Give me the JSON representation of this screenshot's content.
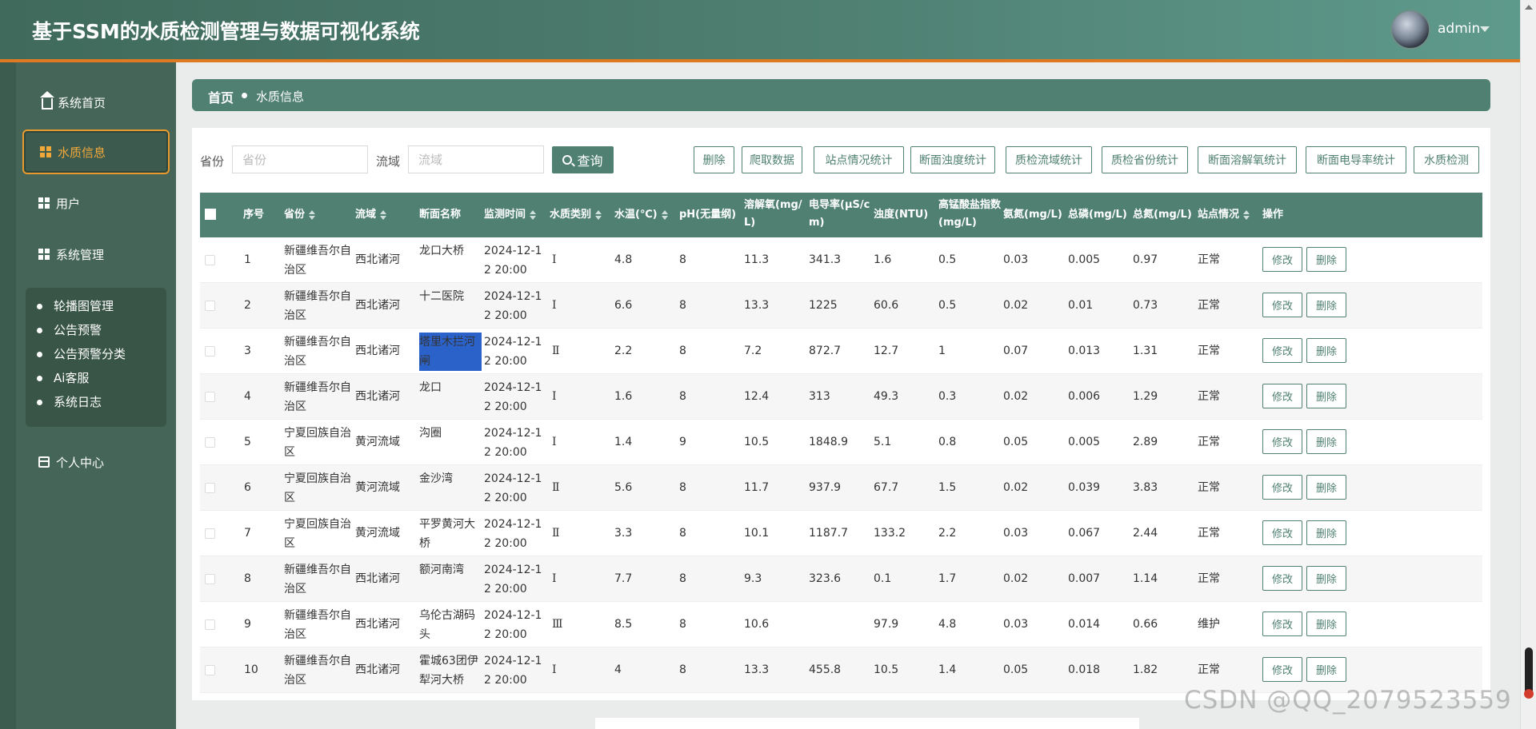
{
  "app": {
    "title": "基于SSM的水质检测管理与数据可视化系统",
    "user": "admin"
  },
  "sidebar": {
    "items": [
      {
        "label": "系统首页",
        "icon": "home-icon"
      },
      {
        "label": "水质信息",
        "icon": "grid-icon"
      },
      {
        "label": "用户",
        "icon": "grid-icon"
      },
      {
        "label": "系统管理",
        "icon": "grid-icon"
      }
    ],
    "submenu": [
      "轮播图管理",
      "公告预警",
      "公告预警分类",
      "Ai客服",
      "系统日志"
    ],
    "personal": "个人中心"
  },
  "breadcrumb": {
    "home": "首页",
    "current": "水质信息"
  },
  "search": {
    "province_label": "省份",
    "province_placeholder": "省份",
    "basin_label": "流域",
    "basin_placeholder": "流域",
    "query_label": "查询"
  },
  "toolbar": [
    "删除",
    "爬取数据",
    "站点情况统计",
    "断面浊度统计",
    "质检流域统计",
    "质检省份统计",
    "断面溶解氧统计",
    "断面电导率统计",
    "水质检测"
  ],
  "table": {
    "headers": [
      "序号",
      "省份",
      "流域",
      "断面名称",
      "监测时间",
      "水质类别",
      "水温(℃)",
      "pH(无量纲)",
      "溶解氧(mg/L)",
      "电导率(μS/cm)",
      "浊度(NTU)",
      "高锰酸盐指数(mg/L)",
      "氨氮(mg/L)",
      "总磷(mg/L)",
      "总氮(mg/L)",
      "站点情况",
      "操作"
    ],
    "edit_label": "修改",
    "delete_label": "删除",
    "rows": [
      {
        "no": "1",
        "province": "新疆维吾尔自治区",
        "basin": "西北诸河",
        "section": "龙口大桥",
        "time": "2024-12-12 20:00",
        "cls": "Ⅰ",
        "temp": "4.8",
        "ph": "8",
        "do": "11.3",
        "cond": "341.3",
        "turb": "1.6",
        "kmn": "0.5",
        "nh": "0.03",
        "tp": "0.005",
        "tn": "0.97",
        "status": "正常"
      },
      {
        "no": "2",
        "province": "新疆维吾尔自治区",
        "basin": "西北诸河",
        "section": "十二医院",
        "time": "2024-12-12 20:00",
        "cls": "Ⅰ",
        "temp": "6.6",
        "ph": "8",
        "do": "13.3",
        "cond": "1225",
        "turb": "60.6",
        "kmn": "0.5",
        "nh": "0.02",
        "tp": "0.01",
        "tn": "0.73",
        "status": "正常"
      },
      {
        "no": "3",
        "province": "新疆维吾尔自治区",
        "basin": "西北诸河",
        "section": "塔里木拦河闸",
        "time": "2024-12-12 20:00",
        "cls": "Ⅱ",
        "temp": "2.2",
        "ph": "8",
        "do": "7.2",
        "cond": "872.7",
        "turb": "12.7",
        "kmn": "1",
        "nh": "0.07",
        "tp": "0.013",
        "tn": "1.31",
        "status": "正常"
      },
      {
        "no": "4",
        "province": "新疆维吾尔自治区",
        "basin": "西北诸河",
        "section": "龙口",
        "time": "2024-12-12 20:00",
        "cls": "Ⅰ",
        "temp": "1.6",
        "ph": "8",
        "do": "12.4",
        "cond": "313",
        "turb": "49.3",
        "kmn": "0.3",
        "nh": "0.02",
        "tp": "0.006",
        "tn": "1.29",
        "status": "正常"
      },
      {
        "no": "5",
        "province": "宁夏回族自治区",
        "basin": "黄河流域",
        "section": "沟圈",
        "time": "2024-12-12 20:00",
        "cls": "Ⅰ",
        "temp": "1.4",
        "ph": "9",
        "do": "10.5",
        "cond": "1848.9",
        "turb": "5.1",
        "kmn": "0.8",
        "nh": "0.05",
        "tp": "0.005",
        "tn": "2.89",
        "status": "正常"
      },
      {
        "no": "6",
        "province": "宁夏回族自治区",
        "basin": "黄河流域",
        "section": "金沙湾",
        "time": "2024-12-12 20:00",
        "cls": "Ⅱ",
        "temp": "5.6",
        "ph": "8",
        "do": "11.7",
        "cond": "937.9",
        "turb": "67.7",
        "kmn": "1.5",
        "nh": "0.02",
        "tp": "0.039",
        "tn": "3.83",
        "status": "正常"
      },
      {
        "no": "7",
        "province": "宁夏回族自治区",
        "basin": "黄河流域",
        "section": "平罗黄河大桥",
        "time": "2024-12-12 20:00",
        "cls": "Ⅱ",
        "temp": "3.3",
        "ph": "8",
        "do": "10.1",
        "cond": "1187.7",
        "turb": "133.2",
        "kmn": "2.2",
        "nh": "0.03",
        "tp": "0.067",
        "tn": "2.44",
        "status": "正常"
      },
      {
        "no": "8",
        "province": "新疆维吾尔自治区",
        "basin": "西北诸河",
        "section": "额河南湾",
        "time": "2024-12-12 20:00",
        "cls": "Ⅰ",
        "temp": "7.7",
        "ph": "8",
        "do": "9.3",
        "cond": "323.6",
        "turb": "0.1",
        "kmn": "1.7",
        "nh": "0.02",
        "tp": "0.007",
        "tn": "1.14",
        "status": "正常"
      },
      {
        "no": "9",
        "province": "新疆维吾尔自治区",
        "basin": "西北诸河",
        "section": "乌伦古湖码头",
        "time": "2024-12-12 20:00",
        "cls": "Ⅲ",
        "temp": "8.5",
        "ph": "8",
        "do": "10.6",
        "cond": "",
        "turb": "97.9",
        "kmn": "4.8",
        "nh": "0.03",
        "tp": "0.014",
        "tn": "0.66",
        "status": "维护"
      },
      {
        "no": "10",
        "province": "新疆维吾尔自治区",
        "basin": "西北诸河",
        "section": "霍城63团伊犁河大桥",
        "time": "2024-12-12 20:00",
        "cls": "Ⅰ",
        "temp": "4",
        "ph": "8",
        "do": "13.3",
        "cond": "455.8",
        "turb": "10.5",
        "kmn": "1.4",
        "nh": "0.05",
        "tp": "0.018",
        "tn": "1.82",
        "status": "正常"
      }
    ]
  },
  "watermark": "CSDN @QQ_2079523559",
  "colors": {
    "primary": "#4f8072",
    "accent": "#e07a22",
    "sidebar": "#446557"
  }
}
